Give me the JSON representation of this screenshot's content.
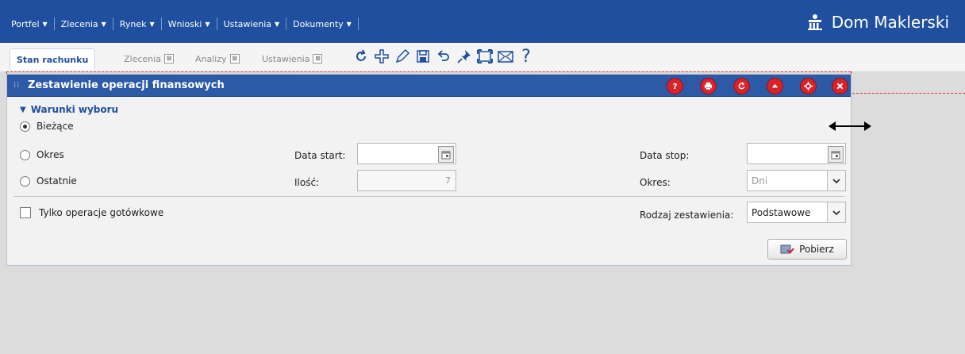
{
  "menu": {
    "items": [
      {
        "label": "Portfel"
      },
      {
        "label": "Zlecenia"
      },
      {
        "label": "Rynek"
      },
      {
        "label": "Wnioski"
      },
      {
        "label": "Ustawienia"
      },
      {
        "label": "Dokumenty"
      }
    ]
  },
  "brand": {
    "name": "Dom Maklerski"
  },
  "tabs": {
    "active": "Stan rachunku",
    "items": [
      {
        "label": "Zlecenia",
        "close": "⊠"
      },
      {
        "label": "Analizy",
        "close": "⊠"
      },
      {
        "label": "Ustawienia",
        "close": "⊠"
      }
    ]
  },
  "toolbar": {
    "icons": [
      "refresh-icon",
      "add-icon",
      "edit-icon",
      "save-icon",
      "undo-icon",
      "pin-icon",
      "fullscreen-icon",
      "mail-icon",
      "help-icon"
    ],
    "help_glyph": "?"
  },
  "panel": {
    "title": "Zestawienie operacji finansowych",
    "header_buttons": [
      "help-icon",
      "print-icon",
      "refresh-icon",
      "collapse-icon",
      "settings-icon",
      "close-icon"
    ],
    "section_title": "Warunki wyboru",
    "radios": [
      {
        "label": "Bieżące",
        "checked": true
      },
      {
        "label": "Okres",
        "checked": false
      },
      {
        "label": "Ostatnie",
        "checked": false
      }
    ],
    "date_start_label": "Data start:",
    "date_start_value": "",
    "date_stop_label": "Data stop:",
    "date_stop_value": "",
    "count_label": "Ilość:",
    "count_value": "7",
    "period_label": "Okres:",
    "period_value": "Dni",
    "cash_only_label": "Tylko operacje gotówkowe",
    "cash_only_checked": false,
    "report_type_label": "Rodzaj zestawienia:",
    "report_type_value": "Podstawowe",
    "fetch_button": "Pobierz"
  },
  "colors": {
    "header_blue": "#1f4f9e",
    "panel_header_blue": "#2d5aa6",
    "header_button_red": "#d8232a",
    "dashed_outline": "#e03030"
  }
}
